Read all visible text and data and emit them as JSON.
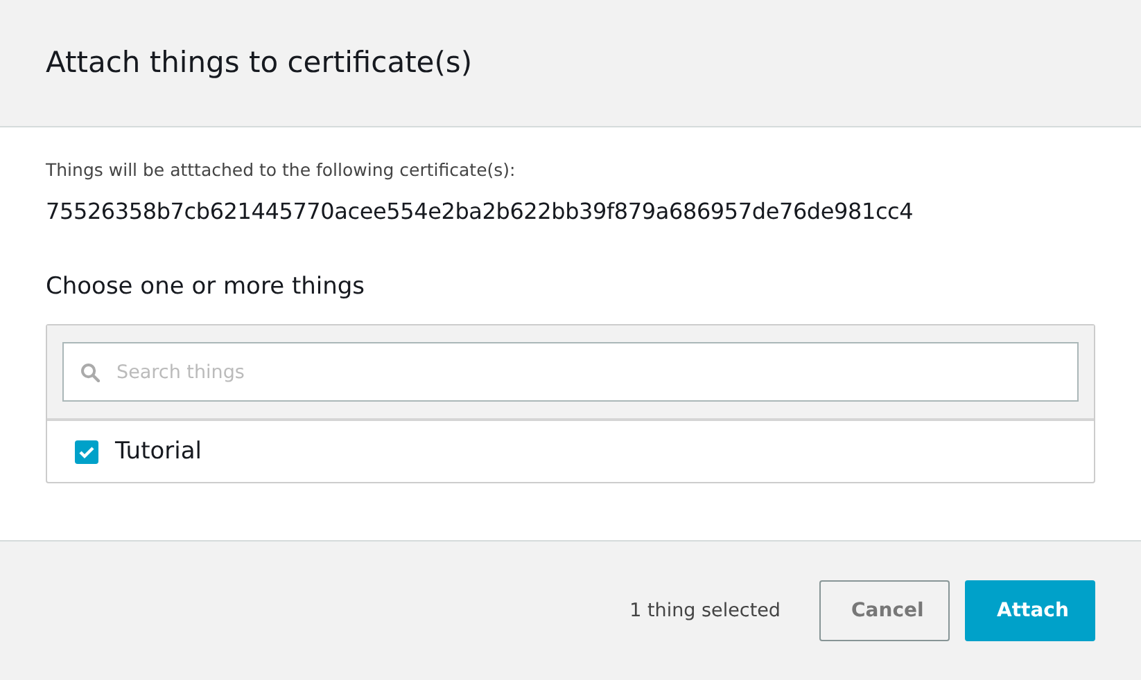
{
  "dialog": {
    "title": "Attach things to certificate(s)"
  },
  "info": {
    "label": "Things will be atttached to the following certificate(s):",
    "certificate_id": "75526358b7cb621445770acee554e2ba2b622bb39f879a686957de76de981cc4"
  },
  "chooser": {
    "heading": "Choose one or more things",
    "search": {
      "placeholder": "Search things"
    },
    "items": [
      {
        "label": "Tutorial",
        "checked": true
      }
    ]
  },
  "footer": {
    "selection_count": "1 thing selected",
    "buttons": [
      {
        "label": "Cancel",
        "kind": "secondary"
      },
      {
        "label": "Attach",
        "kind": "primary"
      }
    ]
  }
}
